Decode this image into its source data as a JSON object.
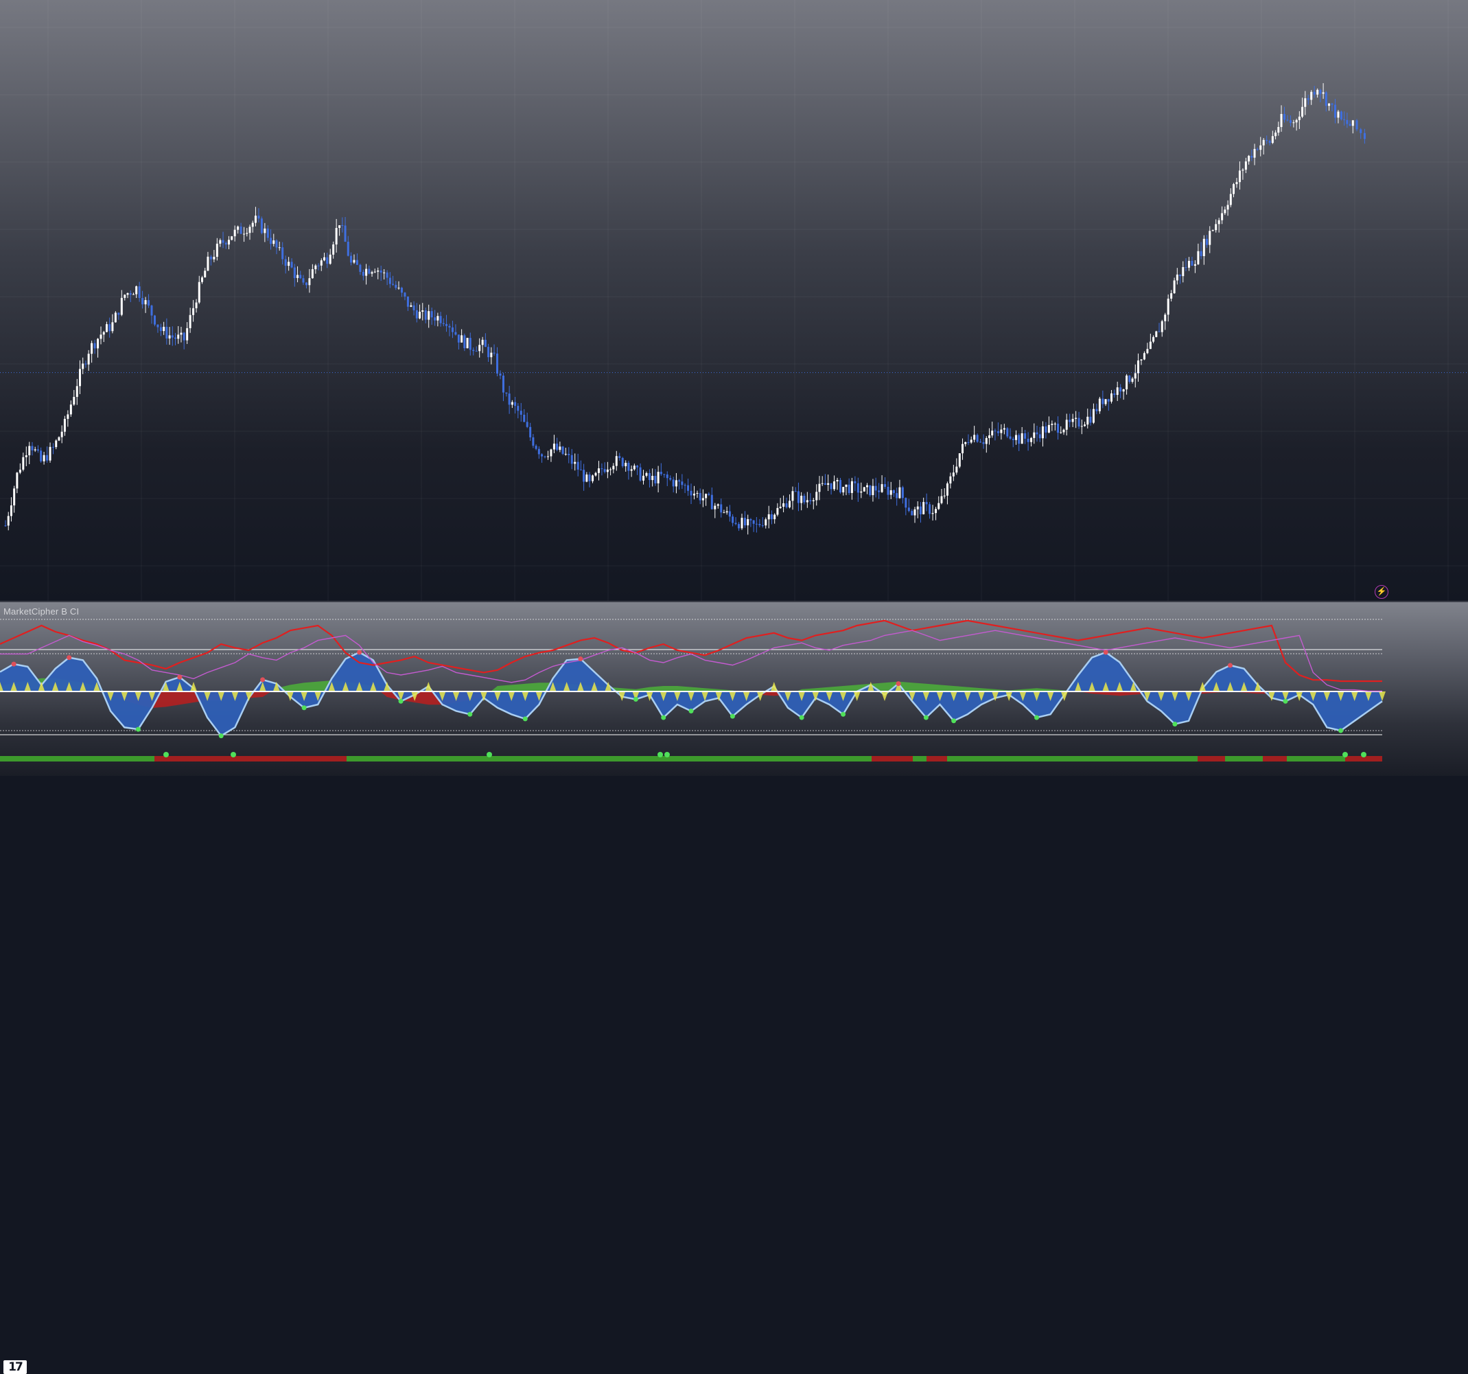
{
  "indicator": {
    "name": "MarketCipher B CI"
  },
  "icons": {
    "alert": "lightning-bolt-icon",
    "logo": "tradingview-logo"
  },
  "colors": {
    "bull_wick": "#ffffff",
    "bear_candle": "#3f6fe0",
    "wave": "#2e5fb6",
    "wave_line": "#a9cef2",
    "money_flow_pos": "#4caf3a",
    "money_flow_neg": "#c21b1b",
    "vwap": "#e9e64a",
    "rsi": "#e11f1f",
    "stoch_green": "#69e34b",
    "stoch_purple": "#c45bd0",
    "dot_green": "#50e05a",
    "dot_red": "#e0505a",
    "trend_green": "#3d9a2c",
    "trend_red": "#a11f1f"
  },
  "chart_data": [
    {
      "type": "candlestick",
      "series": [
        {
          "name": "",
          "x": [
            0,
            17,
            35,
            52,
            70,
            87,
            105,
            122,
            140,
            157,
            175,
            192,
            210,
            228,
            245,
            262,
            280,
            297,
            315,
            332,
            350,
            367,
            385,
            402,
            420,
            437,
            455,
            472,
            490,
            507,
            525,
            542,
            560,
            577,
            595,
            612,
            630,
            647,
            665,
            682,
            700,
            717,
            735,
            752,
            770,
            787,
            805,
            822,
            840,
            857,
            875,
            892,
            910,
            927,
            945,
            962,
            980,
            997,
            1015,
            1032,
            1050,
            1067,
            1085,
            1102,
            1120,
            1137,
            1155,
            1172,
            1190,
            1207,
            1225,
            1242,
            1260,
            1277,
            1295,
            1312,
            1330,
            1347,
            1365,
            1382,
            1400,
            1417,
            1435,
            1452,
            1470,
            1487,
            1505,
            1522,
            1540,
            1557,
            1575,
            1592,
            1610,
            1627,
            1645,
            1662,
            1680,
            1697,
            1715,
            1732,
            1750,
            1767,
            1785,
            1802,
            1820,
            1837,
            1855,
            1872,
            1890,
            1907,
            1925,
            1942,
            1960,
            1977,
            2000
          ],
          "close": [
            10.5,
            22.5,
            30.4,
            25.5,
            28.7,
            34.3,
            44.1,
            51.9,
            55.7,
            58.0,
            65.0,
            66.6,
            61.8,
            56.6,
            55.0,
            54.4,
            64.5,
            72.6,
            76.9,
            79.3,
            80.5,
            82.5,
            79.1,
            74.8,
            71.1,
            66.7,
            72.0,
            73.8,
            82.4,
            72.2,
            70.8,
            71.6,
            69.1,
            65.8,
            61.8,
            59.9,
            59.9,
            59.1,
            54.8,
            52.8,
            53.0,
            49.7,
            40.3,
            37.4,
            31.4,
            27.3,
            28.8,
            27.0,
            24.0,
            20.1,
            23.9,
            25.7,
            25.6,
            22.8,
            21.2,
            22.1,
            20.8,
            19.8,
            17.8,
            16.3,
            14.2,
            11.9,
            10.6,
            10.3,
            13.1,
            14.5,
            17.9,
            16.1,
            18.5,
            20.6,
            19.6,
            19.5,
            18.5,
            19.2,
            18.8,
            18.3,
            13.5,
            14.6,
            14.0,
            19.2,
            27.6,
            32.2,
            30.7,
            32.3,
            32.8,
            30.9,
            31.2,
            33.0,
            33.8,
            34.0,
            34.8,
            36.2,
            40.2,
            42.1,
            44.5,
            48.0,
            52.5,
            58.5,
            68.4,
            71.8,
            74.2,
            79.6,
            84.5,
            90.2,
            96.5,
            100.3,
            101.1,
            106.2,
            105.6,
            110.8,
            114.4,
            109.9,
            106.0,
            104.7,
            101.7
          ],
          "range_low": [
            0,
            120
          ],
          "note": "price axis not labeled; values in relative chart units"
        }
      ],
      "xlim": [
        0,
        2020
      ],
      "ylim": [
        0,
        120
      ],
      "grid": true,
      "horizontal_line_value": 46.6
    },
    {
      "type": "area",
      "title": "MarketCipher B CI",
      "x": [
        0,
        20,
        40,
        60,
        80,
        100,
        120,
        140,
        160,
        180,
        200,
        220,
        240,
        260,
        280,
        300,
        320,
        340,
        360,
        380,
        400,
        420,
        440,
        460,
        480,
        500,
        520,
        540,
        560,
        580,
        600,
        620,
        640,
        660,
        680,
        700,
        720,
        740,
        760,
        780,
        800,
        820,
        840,
        860,
        880,
        900,
        920,
        940,
        960,
        980,
        1000,
        1020,
        1040,
        1060,
        1080,
        1100,
        1120,
        1140,
        1160,
        1180,
        1200,
        1220,
        1240,
        1260,
        1280,
        1300,
        1320,
        1340,
        1360,
        1380,
        1400,
        1420,
        1440,
        1460,
        1480,
        1500,
        1520,
        1540,
        1560,
        1580,
        1600,
        1620,
        1640,
        1660,
        1680,
        1700,
        1720,
        1740,
        1760,
        1780,
        1800,
        1820,
        1840,
        1860,
        1880,
        1900,
        1920,
        1940,
        1960,
        1980,
        2000
      ],
      "series": [
        {
          "name": "",
          "role": "wave",
          "values": [
            30,
            42,
            38,
            10,
            35,
            52,
            48,
            20,
            -30,
            -55,
            -58,
            -25,
            15,
            22,
            5,
            -40,
            -68,
            -55,
            -10,
            18,
            12,
            -8,
            -25,
            -20,
            20,
            50,
            60,
            48,
            10,
            -15,
            -5,
            8,
            -20,
            -30,
            -35,
            -10,
            -25,
            -35,
            -42,
            -20,
            20,
            48,
            50,
            30,
            10,
            -8,
            -12,
            -5,
            -40,
            -20,
            -30,
            -15,
            -10,
            -38,
            -20,
            -5,
            8,
            -25,
            -40,
            -10,
            -20,
            -35,
            0,
            10,
            -5,
            12,
            -15,
            -40,
            -20,
            -45,
            -35,
            -20,
            -10,
            -5,
            -20,
            -40,
            -35,
            -5,
            25,
            52,
            60,
            45,
            15,
            -15,
            -30,
            -50,
            -45,
            5,
            30,
            40,
            35,
            10,
            -10,
            -15,
            -5,
            -20,
            -55,
            -60,
            -45,
            -30,
            -15
          ],
          "range": [
            -80,
            80
          ]
        },
        {
          "name": "",
          "role": "money_flow",
          "values": [
            5,
            8,
            10,
            12,
            12,
            10,
            8,
            5,
            -4,
            -8,
            -12,
            -15,
            -14,
            -12,
            -10,
            -8,
            -8,
            -7,
            -6,
            -5,
            3,
            6,
            8,
            9,
            10,
            9,
            7,
            5,
            -5,
            -8,
            -10,
            -12,
            -12,
            -10,
            -8,
            -5,
            5,
            6,
            7,
            8,
            8,
            7,
            6,
            5,
            4,
            3,
            2,
            4,
            5,
            5,
            4,
            3,
            2,
            1,
            -2,
            -3,
            -4,
            -3,
            2,
            3,
            4,
            5,
            6,
            7,
            8,
            9,
            8,
            7,
            6,
            5,
            4,
            3,
            2,
            1,
            2,
            3,
            2,
            1,
            0,
            -2,
            -3,
            -4,
            -3,
            -2,
            -1,
            -2,
            -3,
            -2,
            -1,
            0,
            -1,
            -2,
            -2,
            -1,
            -1,
            -1,
            -1,
            -1,
            -1,
            -1,
            -1
          ]
        },
        {
          "name": "",
          "role": "rsi",
          "values": [
            55,
            60,
            65,
            70,
            65,
            62,
            58,
            55,
            50,
            42,
            40,
            38,
            35,
            40,
            44,
            48,
            55,
            52,
            50,
            56,
            60,
            66,
            68,
            70,
            62,
            48,
            40,
            38,
            40,
            42,
            45,
            40,
            38,
            36,
            34,
            32,
            34,
            40,
            45,
            48,
            50,
            54,
            58,
            60,
            56,
            50,
            48,
            52,
            55,
            50,
            48,
            46,
            50,
            55,
            60,
            62,
            64,
            60,
            58,
            62,
            64,
            66,
            70,
            72,
            74,
            70,
            66,
            68,
            70,
            72,
            74,
            72,
            70,
            68,
            66,
            64,
            62,
            60,
            58,
            60,
            62,
            64,
            66,
            68,
            66,
            64,
            62,
            60,
            62,
            64,
            66,
            68,
            70,
            40,
            30,
            26,
            26,
            25,
            25,
            25,
            25
          ]
        }
      ],
      "ylim": [
        -80,
        80
      ]
    },
    {
      "type": "bar",
      "title": "",
      "note": "trend strip",
      "segments": [
        {
          "from": 0,
          "to": 225,
          "state": "green"
        },
        {
          "from": 225,
          "to": 505,
          "state": "red"
        },
        {
          "from": 505,
          "to": 1030,
          "state": "green"
        },
        {
          "from": 1030,
          "to": 1270,
          "state": "green"
        },
        {
          "from": 1270,
          "to": 1330,
          "state": "red"
        },
        {
          "from": 1330,
          "to": 1350,
          "state": "green"
        },
        {
          "from": 1350,
          "to": 1380,
          "state": "red"
        },
        {
          "from": 1380,
          "to": 1745,
          "state": "green"
        },
        {
          "from": 1745,
          "to": 1785,
          "state": "red"
        },
        {
          "from": 1785,
          "to": 1840,
          "state": "green"
        },
        {
          "from": 1840,
          "to": 1875,
          "state": "red"
        },
        {
          "from": 1875,
          "to": 1960,
          "state": "green"
        },
        {
          "from": 1960,
          "to": 2014,
          "state": "red"
        }
      ],
      "markers": [
        242,
        340,
        713,
        962,
        972,
        1960,
        1987
      ]
    }
  ]
}
